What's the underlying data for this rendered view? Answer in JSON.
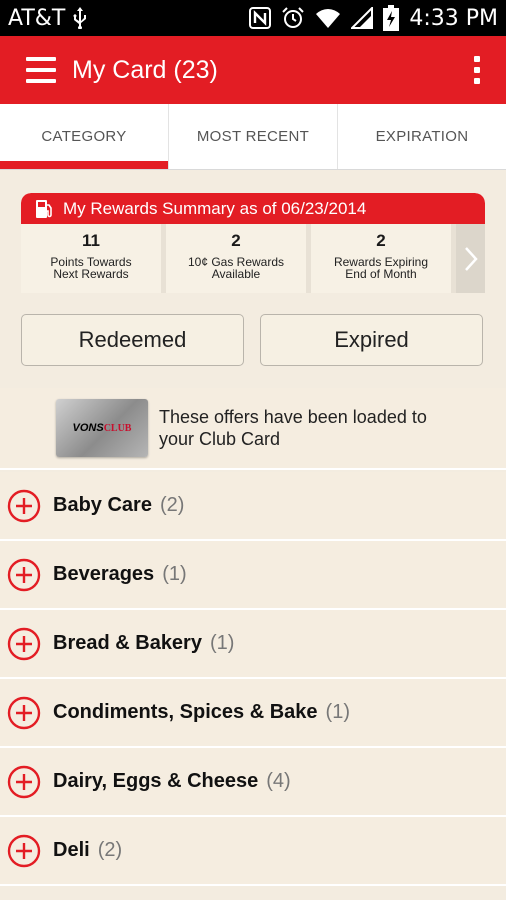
{
  "status_bar": {
    "carrier": "AT&T",
    "time": "4:33 PM",
    "icons": [
      "usb-icon",
      "nfc-icon",
      "alarm-icon",
      "wifi-icon",
      "signal-icon",
      "battery-charging-icon"
    ]
  },
  "app_bar": {
    "title": "My Card (23)",
    "icons": [
      "menu-icon",
      "overflow-icon"
    ],
    "color": "#e31d24"
  },
  "tabs": [
    {
      "label": "CATEGORY",
      "active": true
    },
    {
      "label": "MOST RECENT",
      "active": false
    },
    {
      "label": "EXPIRATION",
      "active": false
    }
  ],
  "rewards": {
    "header": "My Rewards Summary as of 06/23/2014",
    "icon": "fuel-pump-icon",
    "stats": [
      {
        "value": "11",
        "label_line1": "Points Towards",
        "label_line2": "Next Rewards"
      },
      {
        "value": "2",
        "label_line1": "10¢ Gas Rewards",
        "label_line2": "Available"
      },
      {
        "value": "2",
        "label_line1": "Rewards Expiring",
        "label_line2": "End of Month"
      }
    ]
  },
  "buttons": {
    "redeemed": "Redeemed",
    "expired": "Expired"
  },
  "banner": {
    "card_logo_text_1": "VONS",
    "card_logo_text_2": "CLUB",
    "text": "These offers have been loaded to your Club Card"
  },
  "categories": [
    {
      "name": "Baby Care",
      "count": "(2)"
    },
    {
      "name": "Beverages",
      "count": "(1)"
    },
    {
      "name": "Bread & Bakery",
      "count": "(1)"
    },
    {
      "name": "Condiments, Spices & Bake",
      "count": "(1)"
    },
    {
      "name": "Dairy, Eggs & Cheese",
      "count": "(4)"
    },
    {
      "name": "Deli",
      "count": "(2)"
    }
  ]
}
